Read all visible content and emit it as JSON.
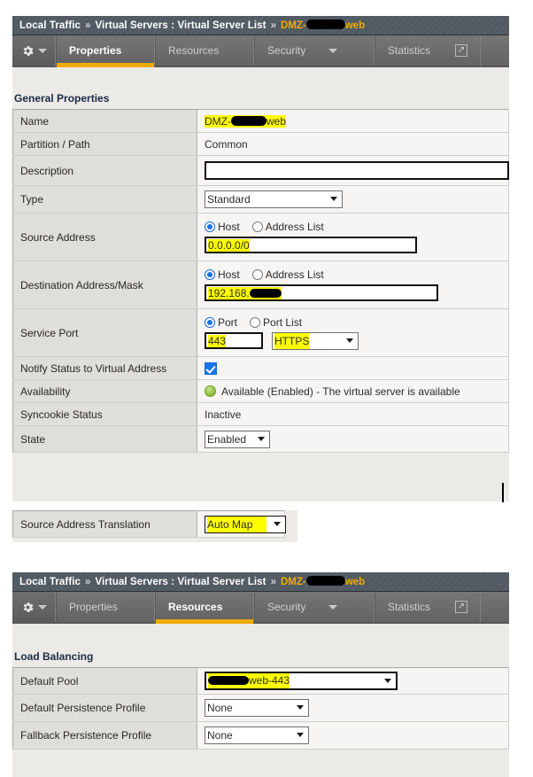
{
  "breadcrumb": {
    "module": "Local Traffic",
    "separator": "»",
    "section": "Virtual Servers : Virtual Server List",
    "object_prefix": "DMZ-",
    "object_suffix": "web"
  },
  "tabs": {
    "gear_icon": "gear-icon",
    "caret_icon": "caret-down-icon",
    "items": [
      {
        "label": "Properties",
        "active_panel1": true,
        "active_panel2": false,
        "has_caret": false
      },
      {
        "label": "Resources",
        "active_panel1": false,
        "active_panel2": true,
        "has_caret": false
      },
      {
        "label": "Security",
        "active_panel1": false,
        "active_panel2": false,
        "has_caret": true
      },
      {
        "label": "Statistics",
        "active_panel1": false,
        "active_panel2": false,
        "has_caret": false
      }
    ],
    "expand_icon": "external-link-icon"
  },
  "general_properties": {
    "title": "General Properties",
    "name": {
      "label": "Name",
      "value_prefix": "DMZ-",
      "value_suffix": "web",
      "highlighted": true
    },
    "partition": {
      "label": "Partition / Path",
      "value": "Common"
    },
    "description": {
      "label": "Description",
      "value": "",
      "placeholder": ""
    },
    "type": {
      "label": "Type",
      "value": "Standard"
    },
    "source_address": {
      "label": "Source Address",
      "radio_host": "Host",
      "radio_address_list": "Address List",
      "selected": "Host",
      "value": "0.0.0.0/0",
      "highlighted": true
    },
    "destination": {
      "label": "Destination Address/Mask",
      "radio_host": "Host",
      "radio_address_list": "Address List",
      "selected": "Host",
      "value_prefix": "192.168.",
      "highlighted": true
    },
    "service_port": {
      "label": "Service Port",
      "radio_port": "Port",
      "radio_port_list": "Port List",
      "selected": "Port",
      "port": "443",
      "service": "HTTPS",
      "highlighted": true
    },
    "notify_status": {
      "label": "Notify Status to Virtual Address",
      "checked": true
    },
    "availability": {
      "label": "Availability",
      "status_icon": "status-available-green",
      "value": "Available (Enabled) - The virtual server is available"
    },
    "syncookie": {
      "label": "Syncookie Status",
      "value": "Inactive"
    },
    "state": {
      "label": "State",
      "value": "Enabled"
    }
  },
  "source_address_translation": {
    "label": "Source Address Translation",
    "value": "Auto Map",
    "highlighted": true
  },
  "load_balancing": {
    "title": "Load Balancing",
    "default_pool": {
      "label": "Default Pool",
      "value_suffix": "web-443",
      "highlighted": true
    },
    "default_persistence": {
      "label": "Default Persistence Profile",
      "value": "None"
    },
    "fallback_persistence": {
      "label": "Fallback Persistence Profile",
      "value": "None"
    }
  },
  "colors": {
    "accent_yellow": "#f0ab00",
    "highlight": "#ffff00",
    "breadcrumb_bg": "#515962",
    "tabstrip_bg": "#6b6b6b",
    "panel_bg": "#eceae6",
    "label_cell_bg": "#dededa",
    "radio_blue": "#1a73e8",
    "status_green": "#9ccb4a",
    "heading_text": "#1b2a45"
  }
}
